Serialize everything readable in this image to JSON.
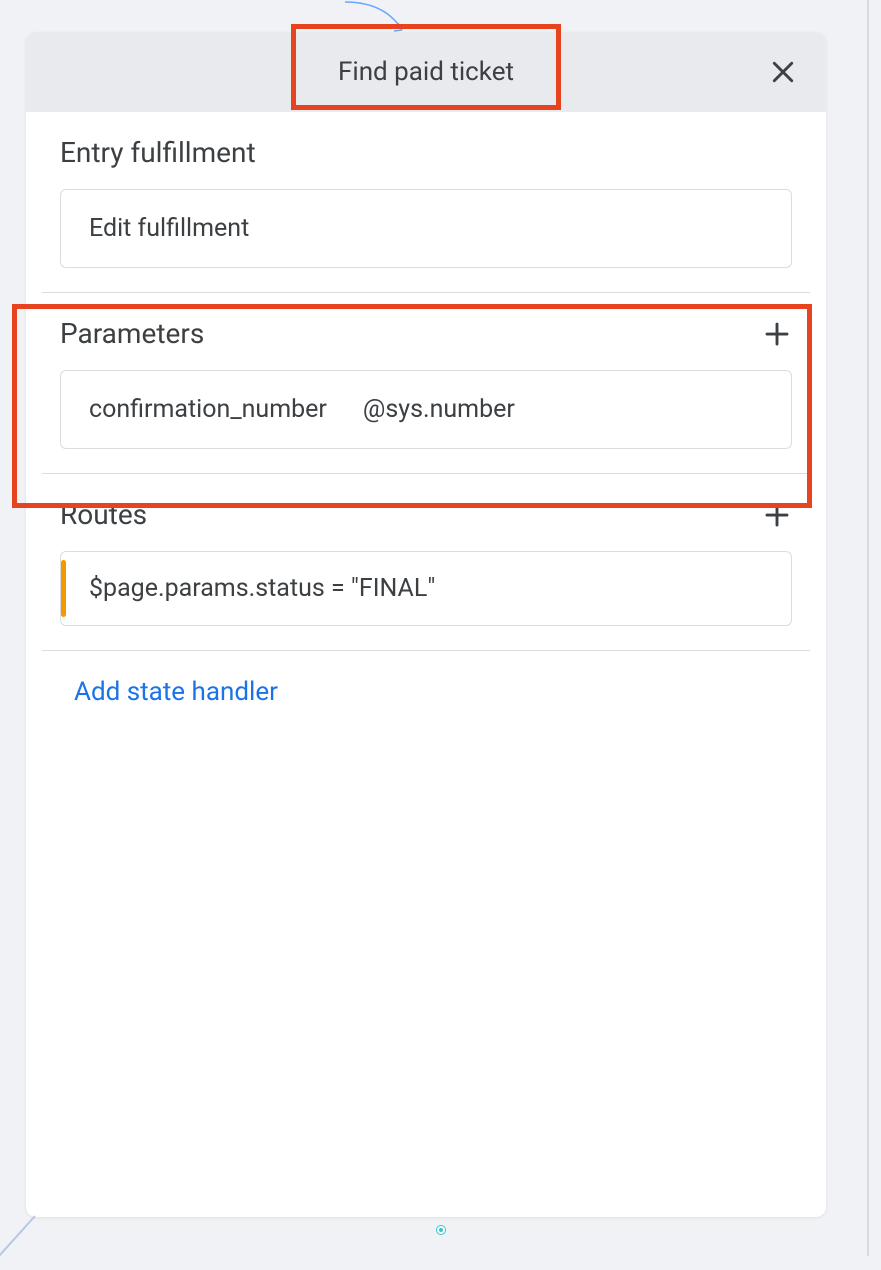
{
  "header": {
    "title": "Find paid ticket"
  },
  "sections": {
    "entry": {
      "title": "Entry fulfillment",
      "box_label": "Edit fulfillment"
    },
    "parameters": {
      "title": "Parameters",
      "items": [
        {
          "name": "confirmation_number",
          "type": "@sys.number"
        }
      ]
    },
    "routes": {
      "title": "Routes",
      "items": [
        {
          "condition": "$page.params.status = \"FINAL\""
        }
      ]
    }
  },
  "links": {
    "add_state_handler": "Add state handler"
  }
}
